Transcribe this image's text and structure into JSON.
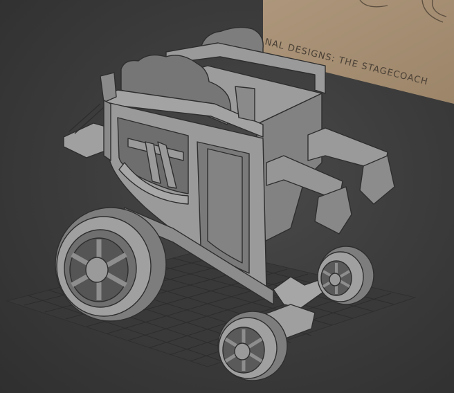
{
  "viewport": {
    "background": "#3a3a3a",
    "grid_color": "#2a2a2a",
    "model_color": "#8e8e8e",
    "edge_color": "#2e2e2e"
  },
  "reference_image": {
    "caption": "NAL DESIGNS: THE STAGECOACH",
    "paper_color": "#a48e74"
  },
  "model": {
    "icon": "stagecoach-model-icon"
  }
}
